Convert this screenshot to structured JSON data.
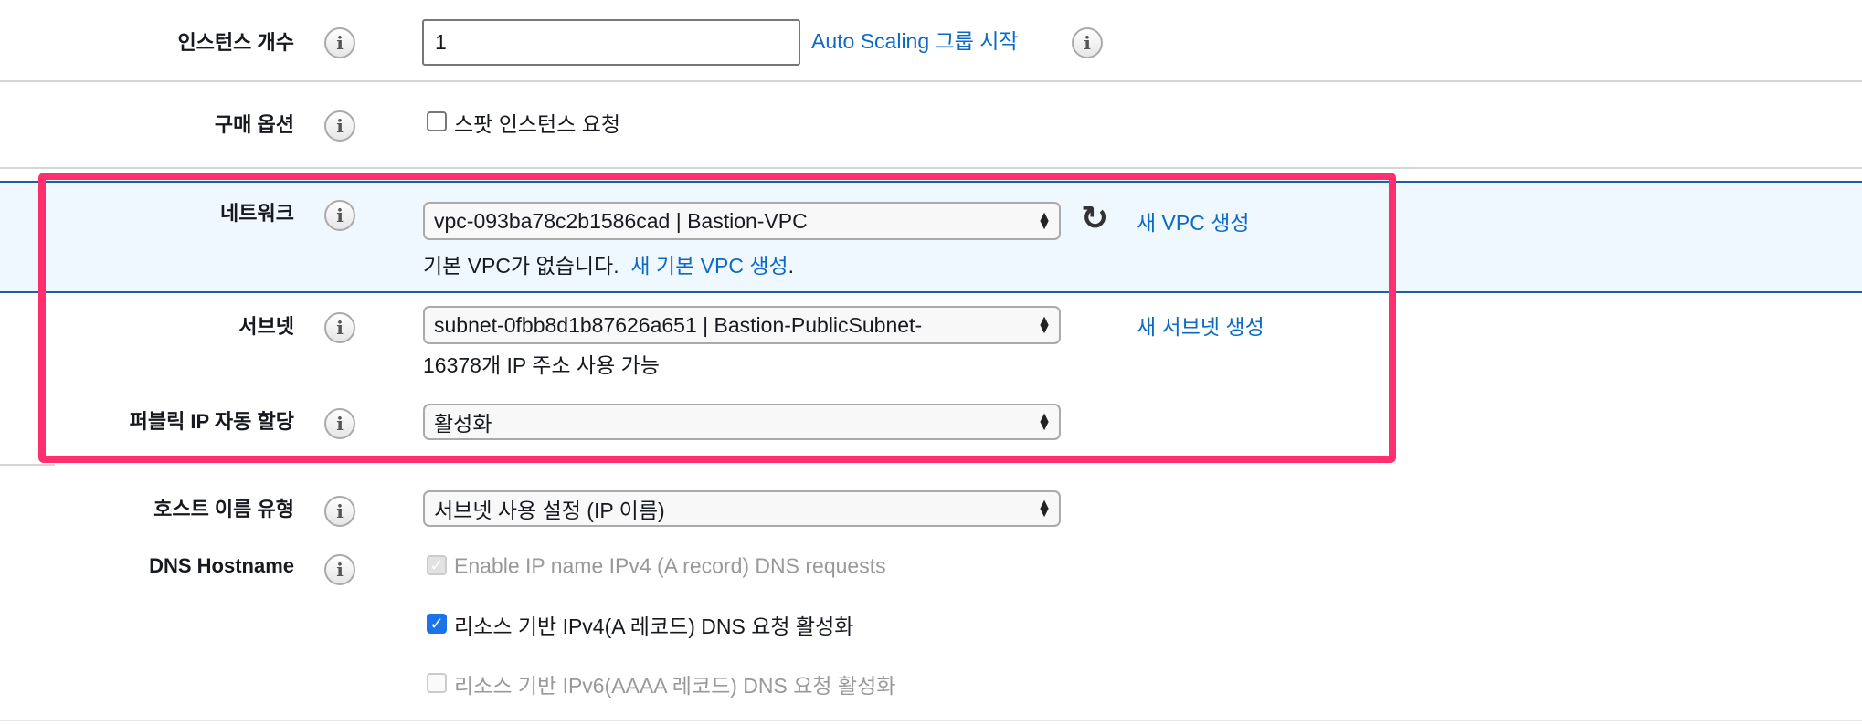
{
  "instance_count": {
    "label": "인스턴스 개수",
    "value": "1",
    "link": "Auto Scaling 그룹 시작"
  },
  "purchase_option": {
    "label": "구매 옵션",
    "checkbox": "스팟 인스턴스 요청",
    "checked": false
  },
  "network": {
    "label": "네트워크",
    "selected": "vpc-093ba78c2b1586cad | Bastion-VPC",
    "refresh_icon": "refresh-icon",
    "link": "새 VPC 생성",
    "note": "기본 VPC가 없습니다.",
    "note_link": "새 기본 VPC 생성",
    "note_end": "."
  },
  "subnet": {
    "label": "서브넷",
    "selected": "subnet-0fbb8d1b87626a651 | Bastion-PublicSubnet-",
    "link": "새 서브넷 생성",
    "note": "16378개 IP 주소 사용 가능"
  },
  "public_ip": {
    "label": "퍼블릭 IP 자동 할당",
    "selected": "활성화"
  },
  "hostname_type": {
    "label": "호스트 이름 유형",
    "selected": "서브넷 사용 설정 (IP 이름)"
  },
  "dns_hostname": {
    "label": "DNS Hostname",
    "options": [
      {
        "label": "Enable IP name IPv4 (A record) DNS requests",
        "checked": true,
        "disabled": true
      },
      {
        "label": "리소스 기반 IPv4(A 레코드) DNS 요청 활성화",
        "checked": true,
        "disabled": false
      },
      {
        "label": "리소스 기반 IPv6(AAAA 레코드) DNS 요청 활성화",
        "checked": false,
        "disabled": true
      }
    ]
  },
  "colors": {
    "highlight": "#ff2e6e",
    "link": "#0d6ac4",
    "row_bg": "#f0f8ff",
    "row_border": "#1f5fa8"
  }
}
